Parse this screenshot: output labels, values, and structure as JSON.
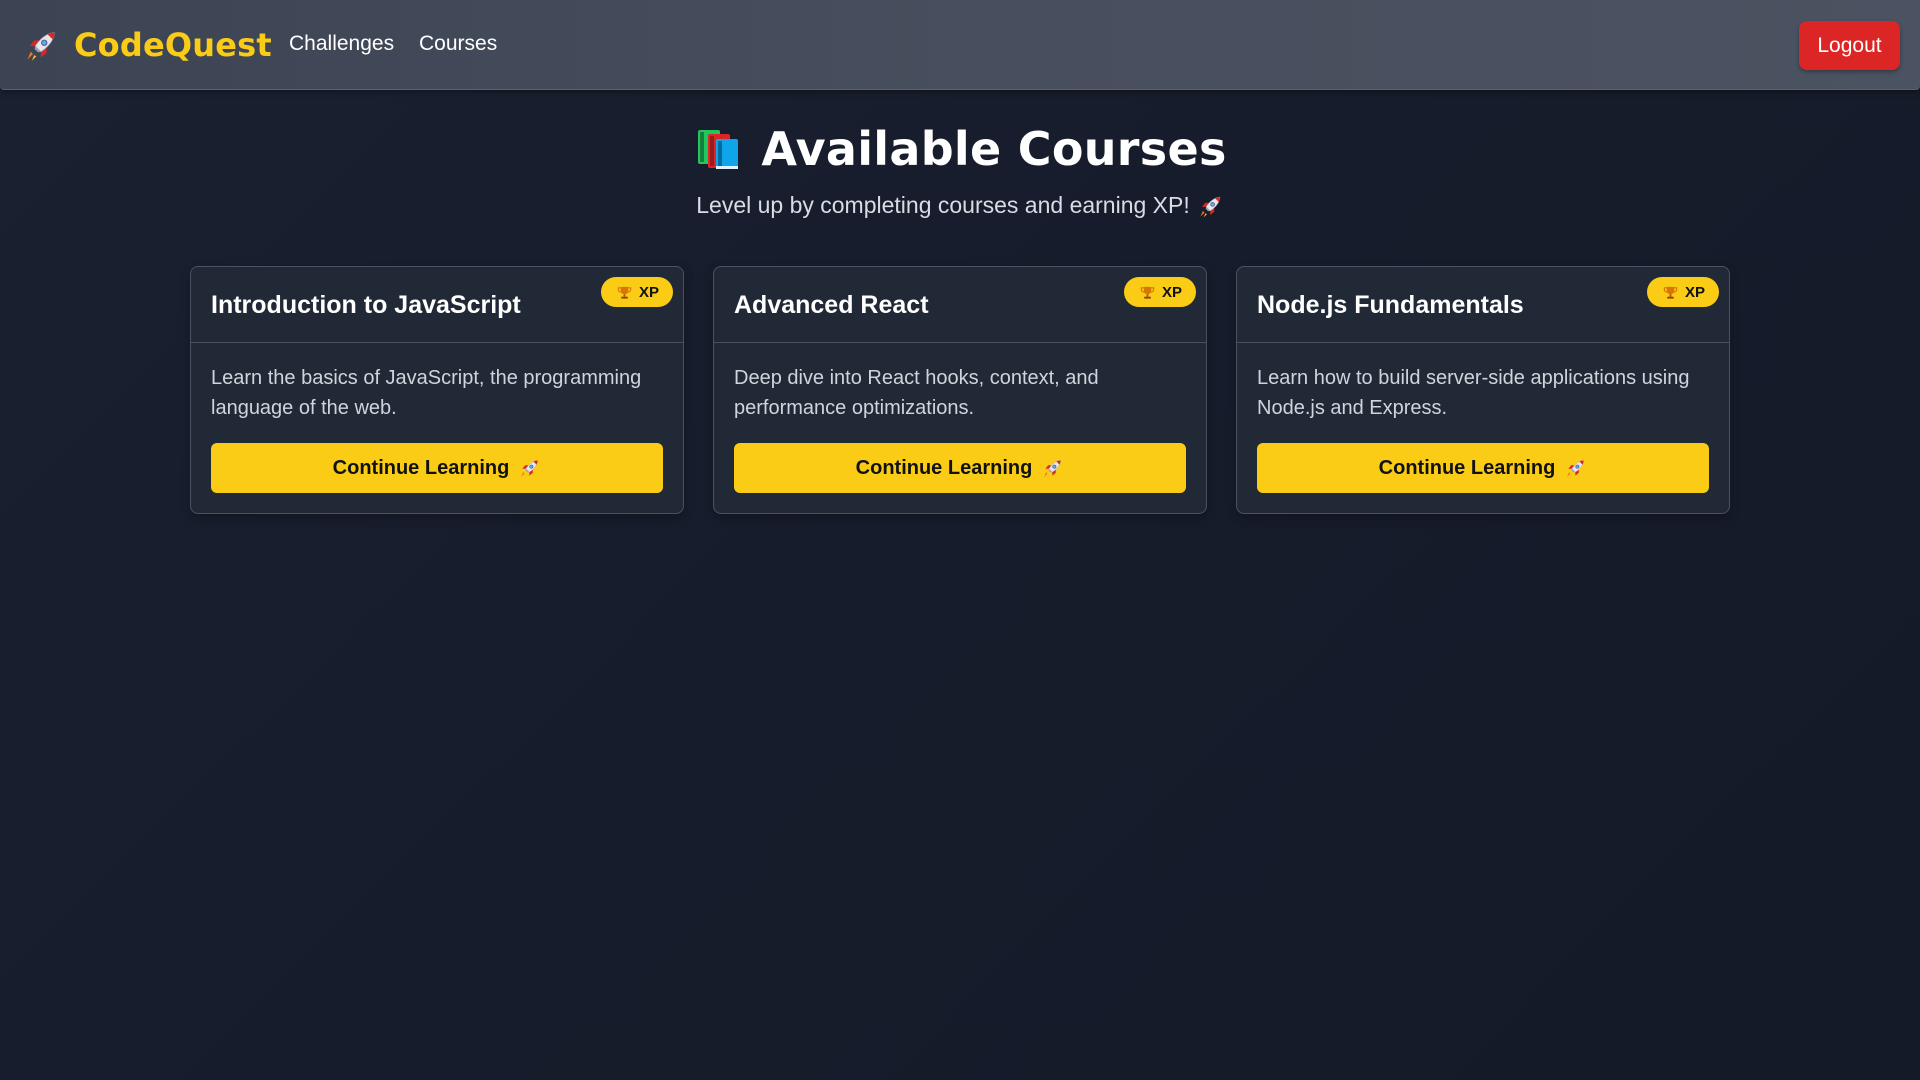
{
  "nav": {
    "brand": "CodeQuest",
    "brand_icon": "rocket-icon",
    "links": [
      {
        "label": "Challenges"
      },
      {
        "label": "Courses"
      }
    ],
    "logout_label": "Logout"
  },
  "header": {
    "title": "Available Courses",
    "title_icon": "books-icon",
    "subtitle": "Level up by completing courses and earning XP!",
    "subtitle_icon": "rocket-icon"
  },
  "courses": [
    {
      "title": "Introduction to JavaScript",
      "badge": "XP",
      "badge_icon": "trophy-icon",
      "description": "Learn the basics of JavaScript, the programming language of the web.",
      "button": "Continue Learning",
      "button_icon": "rocket-icon"
    },
    {
      "title": "Advanced React",
      "badge": "XP",
      "badge_icon": "trophy-icon",
      "description": "Deep dive into React hooks, context, and performance optimizations.",
      "button": "Continue Learning",
      "button_icon": "rocket-icon"
    },
    {
      "title": "Node.js Fundamentals",
      "badge": "XP",
      "badge_icon": "trophy-icon",
      "description": "Learn how to build server-side applications using Node.js and Express.",
      "button": "Continue Learning",
      "button_icon": "rocket-icon"
    }
  ],
  "colors": {
    "accent": "#facc15",
    "danger": "#dc2626",
    "background": "#171d2b",
    "card": "#222936",
    "navbar": "#464d5c"
  }
}
